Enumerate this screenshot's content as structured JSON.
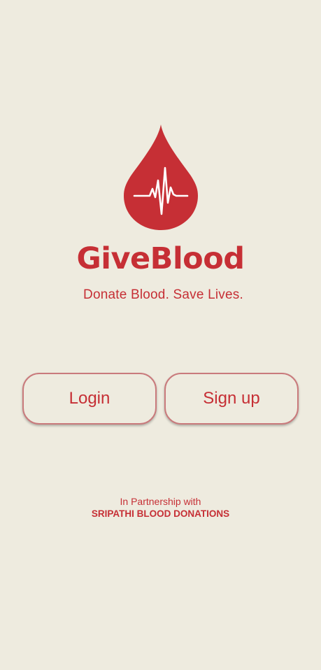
{
  "app": {
    "title": "GiveBlood",
    "tagline": "Donate Blood. Save Lives."
  },
  "auth": {
    "login_label": "Login",
    "signup_label": "Sign up"
  },
  "partner": {
    "intro": "In Partnership with",
    "name": "SRIPATHI BLOOD DONATIONS"
  },
  "icons": {
    "logo": "blood-drop-heartbeat-icon"
  },
  "colors": {
    "background": "#EEEBDF",
    "brand_red": "#C62F35",
    "button_border": "#C97A7C"
  }
}
